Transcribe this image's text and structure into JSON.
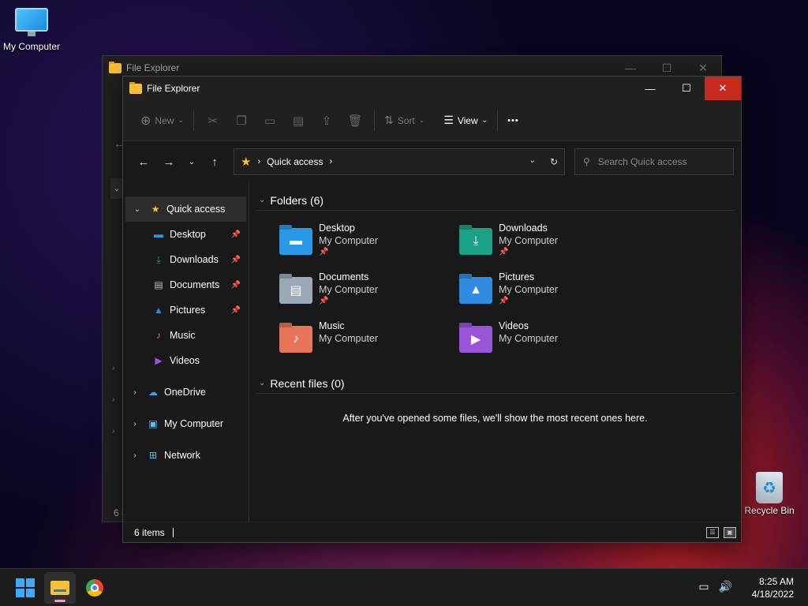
{
  "desktop": {
    "my_computer_label": "My Computer",
    "recycle_bin_label": "Recycle Bin"
  },
  "back_window": {
    "title": "File Explorer",
    "status": "6 i"
  },
  "window": {
    "title": "File Explorer"
  },
  "toolbar": {
    "new_label": "New",
    "sort_label": "Sort",
    "view_label": "View",
    "more_label": "•••"
  },
  "address": {
    "path": "Quick access",
    "search_placeholder": "Search Quick access"
  },
  "sidebar": {
    "items": [
      {
        "label": "Quick access"
      },
      {
        "label": "Desktop"
      },
      {
        "label": "Downloads"
      },
      {
        "label": "Documents"
      },
      {
        "label": "Pictures"
      },
      {
        "label": "Music"
      },
      {
        "label": "Videos"
      },
      {
        "label": "OneDrive"
      },
      {
        "label": "My Computer"
      },
      {
        "label": "Network"
      }
    ]
  },
  "folders_section": {
    "heading": "Folders (6)",
    "items": [
      {
        "name": "Desktop",
        "location": "My Computer",
        "color": "#2a9ae8"
      },
      {
        "name": "Downloads",
        "location": "My Computer",
        "color": "#1aa187"
      },
      {
        "name": "Documents",
        "location": "My Computer",
        "color": "#9aa8b8"
      },
      {
        "name": "Pictures",
        "location": "My Computer",
        "color": "#2f8ce0"
      },
      {
        "name": "Music",
        "location": "My Computer",
        "color": "#e8745a"
      },
      {
        "name": "Videos",
        "location": "My Computer",
        "color": "#9a54d8"
      }
    ]
  },
  "recent_section": {
    "heading": "Recent files (0)",
    "empty_message": "After you've opened some files, we'll show the most recent ones here."
  },
  "statusbar": {
    "count": "6 items"
  },
  "taskbar": {
    "time": "8:25 AM",
    "date": "4/18/2022"
  }
}
